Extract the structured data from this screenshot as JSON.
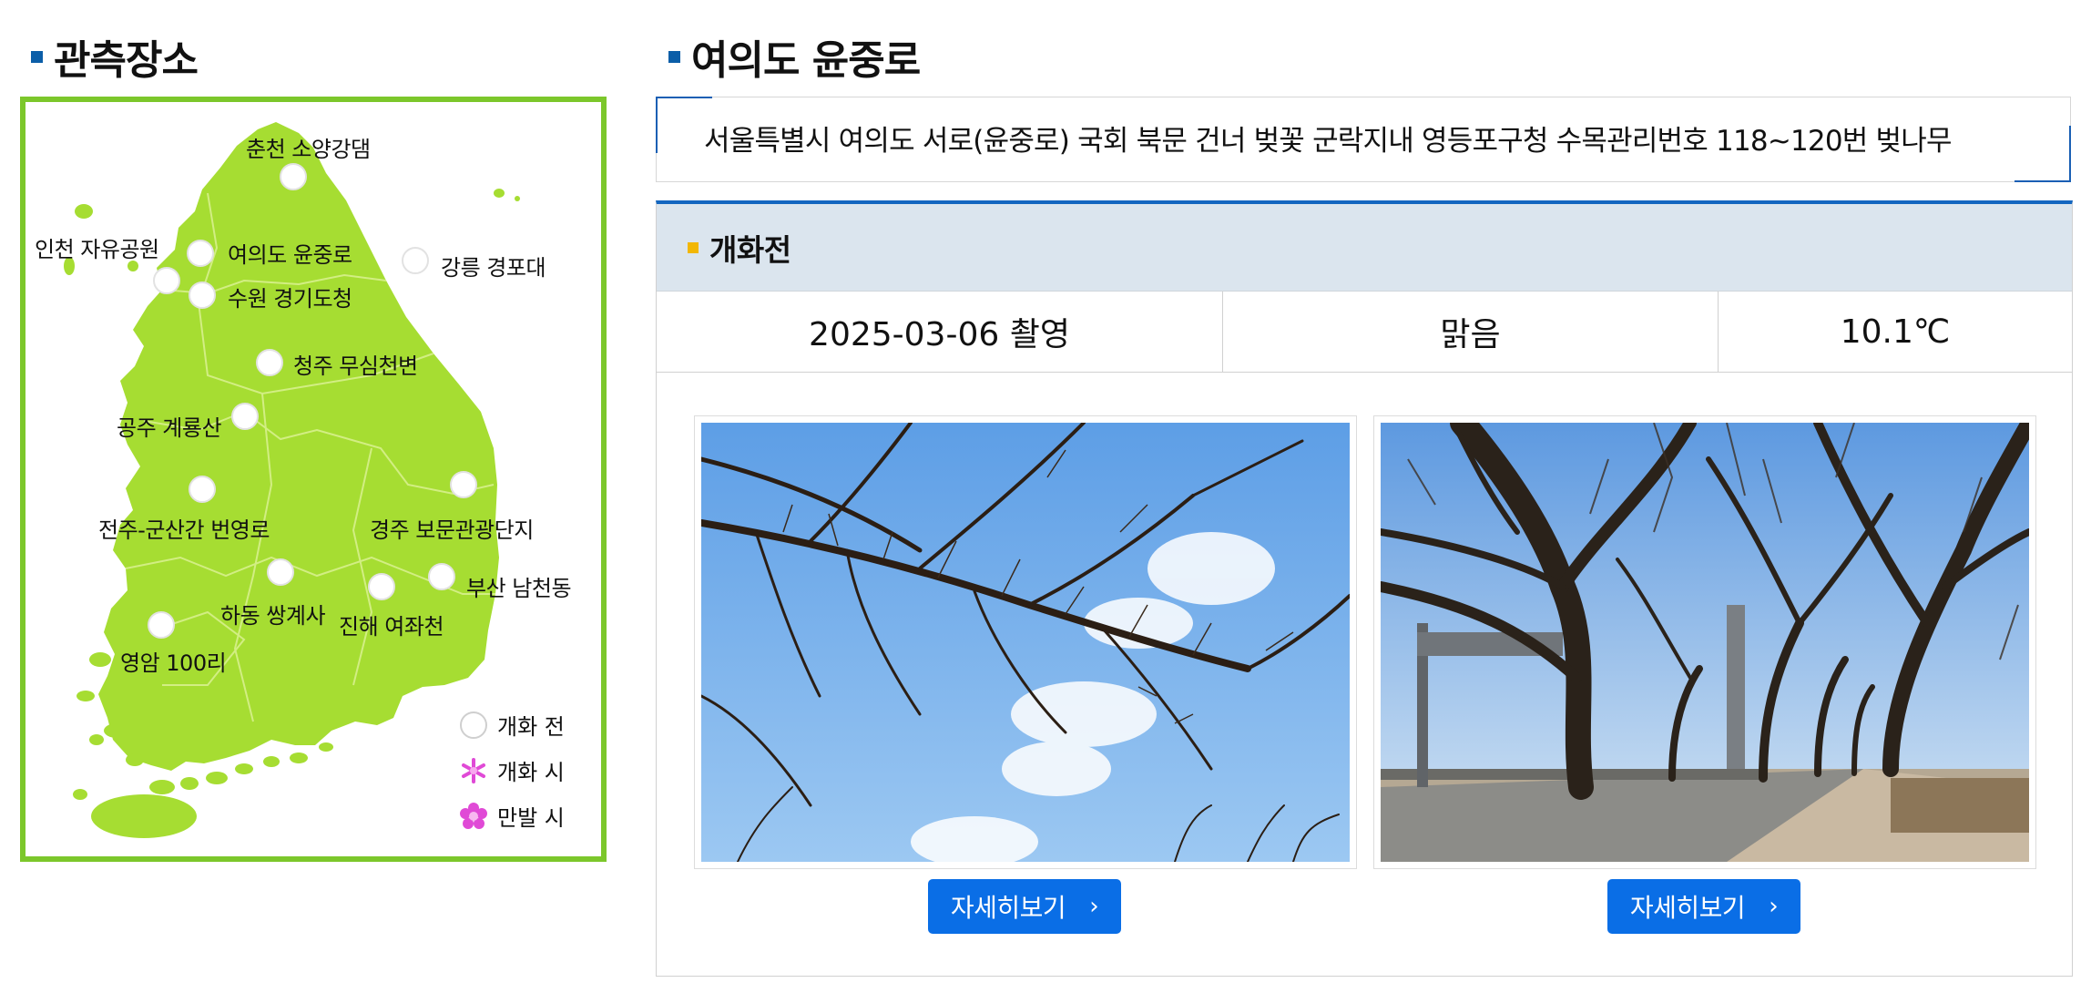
{
  "left_section": {
    "title": "관측장소"
  },
  "map": {
    "land_color": "#a6dd32",
    "border_color": "#7cc72b",
    "locations": [
      {
        "label": "춘천 소양강댐"
      },
      {
        "label": "인천 자유공원"
      },
      {
        "label": "여의도 윤중로"
      },
      {
        "label": "강릉 경포대"
      },
      {
        "label": "수원 경기도청"
      },
      {
        "label": "청주 무심천변"
      },
      {
        "label": "공주 계룡산"
      },
      {
        "label": "전주-군산간 번영로"
      },
      {
        "label": "경주 보문관광단지"
      },
      {
        "label": "부산 남천동"
      },
      {
        "label": "하동 쌍계사"
      },
      {
        "label": "진해 여좌천"
      },
      {
        "label": "영암 100리"
      }
    ],
    "legend": [
      {
        "label": "개화 전",
        "icon": "empty-circle-icon"
      },
      {
        "label": "개화 시",
        "icon": "small-flower-icon",
        "color": "#e04ad6"
      },
      {
        "label": "만발 시",
        "icon": "full-flower-icon",
        "color": "#e04ad6"
      }
    ]
  },
  "right_section": {
    "title": "여의도 윤중로",
    "address": "서울특별시 여의도 서로(윤중로) 국회 북문 건너 벚꽃 군락지내 영등포구청 수목관리번호 118~120번 벚나무",
    "status_panel": {
      "title": "개화전",
      "date": "2025-03-06 촬영",
      "weather": "맑음",
      "temperature": "10.1℃"
    },
    "photos": [
      {
        "alt": "벚나무 가지와 하늘",
        "button_label": "자세히보기"
      },
      {
        "alt": "윤중로 가로수길",
        "button_label": "자세히보기"
      }
    ]
  },
  "colors": {
    "accent_blue": "#1366c0",
    "button_blue": "#0a6ee6",
    "title_bullet": "#0b5ea8",
    "panel_bullet": "#f2b705",
    "panel_head_bg": "#dbe5ee"
  }
}
